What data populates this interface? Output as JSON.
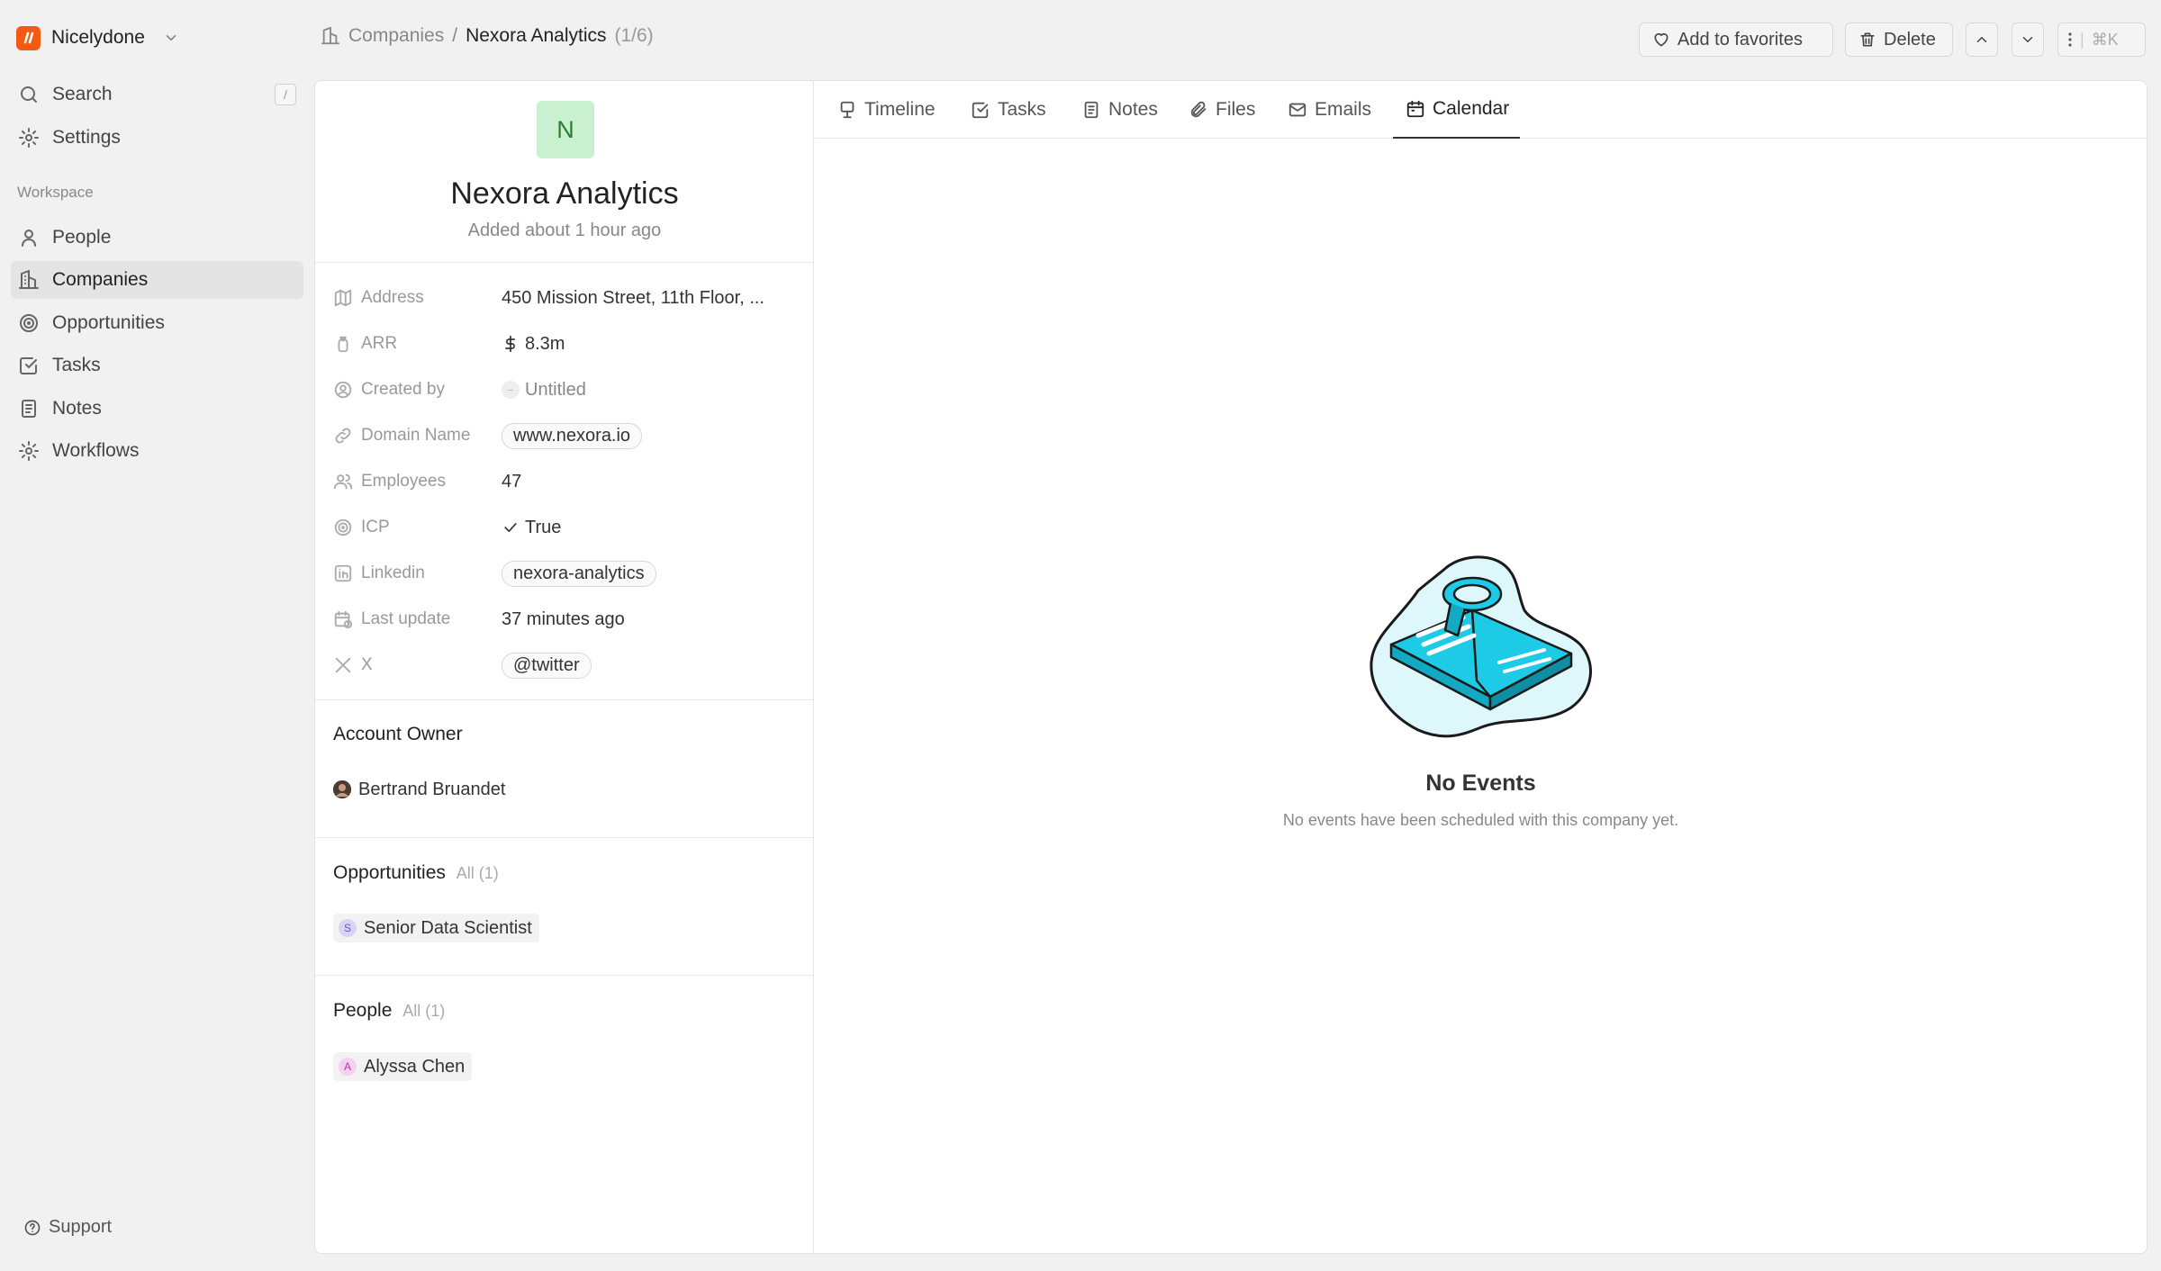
{
  "workspace": {
    "name": "Nicelydone",
    "logo_letter": "n"
  },
  "sidebar": {
    "search_label": "Search",
    "search_shortcut": "/",
    "settings_label": "Settings",
    "section_label": "Workspace",
    "items": [
      {
        "label": "People",
        "icon": "user-icon"
      },
      {
        "label": "Companies",
        "icon": "building-icon"
      },
      {
        "label": "Opportunities",
        "icon": "target-icon"
      },
      {
        "label": "Tasks",
        "icon": "checkbox-icon"
      },
      {
        "label": "Notes",
        "icon": "note-icon"
      },
      {
        "label": "Workflows",
        "icon": "gear-icon"
      }
    ],
    "support_label": "Support"
  },
  "breadcrumb": {
    "parent": "Companies",
    "separator": "/",
    "current": "Nexora Analytics",
    "count": "(1/6)"
  },
  "toolbar": {
    "favorite_label": "Add to favorites",
    "delete_label": "Delete",
    "menu_shortcut": "⌘K"
  },
  "company": {
    "initial": "N",
    "name": "Nexora Analytics",
    "added": "Added about 1 hour ago",
    "fields": {
      "address": {
        "label": "Address",
        "value": "450 Mission Street, 11th Floor, ..."
      },
      "arr": {
        "label": "ARR",
        "value": "8.3m"
      },
      "created_by": {
        "label": "Created by",
        "value": "Untitled"
      },
      "domain": {
        "label": "Domain Name",
        "value": "www.nexora.io"
      },
      "employees": {
        "label": "Employees",
        "value": "47"
      },
      "icp": {
        "label": "ICP",
        "value": "True"
      },
      "linkedin": {
        "label": "Linkedin",
        "value": "nexora-analytics"
      },
      "last_update": {
        "label": "Last update",
        "value": "37 minutes ago"
      },
      "x": {
        "label": "X",
        "value": "@twitter"
      }
    },
    "account_owner": {
      "title": "Account Owner",
      "name": "Bertrand Bruandet"
    },
    "opportunities": {
      "title": "Opportunities",
      "all": "All",
      "count": "(1)",
      "item": "Senior Data Scientist",
      "item_initial": "S"
    },
    "people": {
      "title": "People",
      "all": "All",
      "count": "(1)",
      "item": "Alyssa Chen",
      "item_initial": "A"
    }
  },
  "tabs": [
    "Timeline",
    "Tasks",
    "Notes",
    "Files",
    "Emails",
    "Calendar"
  ],
  "active_tab": "Calendar",
  "empty_state": {
    "title": "No Events",
    "subtitle": "No events have been scheduled with this company yet."
  },
  "colors": {
    "brand": "#f55a14",
    "illustration": "#1ecbe6"
  }
}
